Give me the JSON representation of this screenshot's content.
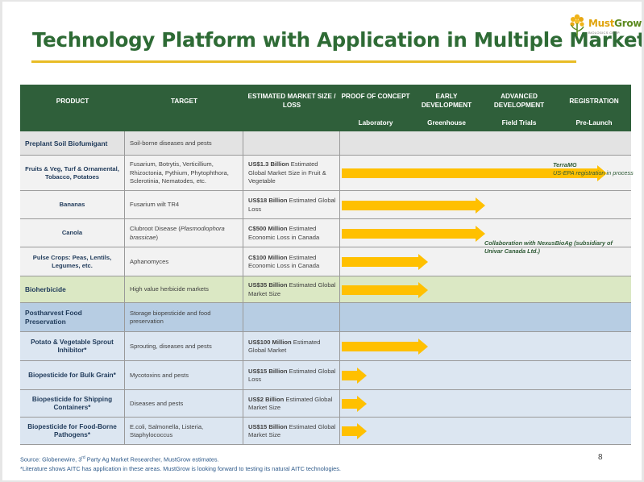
{
  "title": "Technology Platform with Application in Multiple Markets",
  "logo": {
    "brand_part1": "Must",
    "brand_part2": "Grow",
    "subtitle": "BIOLOGICS CORP."
  },
  "header": {
    "product": "PRODUCT",
    "target": "TARGET",
    "market_size": "ESTIMATED MARKET SIZE / LOSS",
    "stages": [
      {
        "label": "PROOF OF CONCEPT",
        "sub": "Laboratory"
      },
      {
        "label": "EARLY DEVELOPMENT",
        "sub": "Greenhouse"
      },
      {
        "label": "ADVANCED DEVELOPMENT",
        "sub": "Field Trials"
      },
      {
        "label": "REGISTRATION",
        "sub": "Pre-Launch"
      }
    ]
  },
  "rows": [
    {
      "kind": "category",
      "product": "Preplant Soil Biofumigant",
      "target": "Soil-borne diseases and pests",
      "market_bold": "",
      "market_rest": ""
    },
    {
      "kind": "item",
      "product": "Fruits & Veg, Turf & Ornamental, Tobacco, Potatoes",
      "target": "Fusarium, Botrytis, Verticillium, Rhizoctonia, Pythium, Phytophthora, Sclerotinia, Nematodes, etc.",
      "market_bold": "US$1.3 Billion",
      "market_rest": " Estimated Global Market Size in Fruit & Vegetable",
      "progress_stage": 3.7
    },
    {
      "kind": "item",
      "product": "Bananas",
      "target": "Fusarium wilt TR4",
      "market_bold": "US$18 Billion",
      "market_rest": " Estimated Global Loss",
      "progress_stage": 2.0
    },
    {
      "kind": "item",
      "product": "Canola",
      "target_pre": "Clubroot Disease (",
      "target_it": "Plasmodiophora brassicae",
      "target_post": ")",
      "market_bold": "C$500 Million",
      "market_rest": " Estimated Economic Loss in Canada",
      "progress_stage": 2.0
    },
    {
      "kind": "item",
      "product": "Pulse Crops: Peas, Lentils, Legumes, etc.",
      "target": "Aphanomyces",
      "market_bold": "C$100 Million",
      "market_rest": " Estimated Economic Loss in Canada",
      "progress_stage": 1.2
    },
    {
      "kind": "category",
      "product": "Bioherbicide",
      "target": "High value herbicide markets",
      "market_bold": "US$35 Billion",
      "market_rest": " Estimated Global Market Size",
      "progress_stage": 1.2
    },
    {
      "kind": "category",
      "product": "Postharvest Food Preservation",
      "target": "Storage biopesticide and food preservation",
      "market_bold": "",
      "market_rest": ""
    },
    {
      "kind": "item",
      "product": "Potato & Vegetable Sprout Inhibitor*",
      "target": "Sprouting, diseases and pests",
      "market_bold": "US$100 Million",
      "market_rest": " Estimated Global Market",
      "progress_stage": 1.2
    },
    {
      "kind": "item",
      "product": "Biopesticide for Bulk Grain*",
      "target": "Mycotoxins and pests",
      "market_bold": "US$15 Billion",
      "market_rest": " Estimated Global Loss",
      "progress_stage": 0.35
    },
    {
      "kind": "item",
      "product": "Biopesticide for Shipping Containers*",
      "target": "Diseases and pests",
      "market_bold": "US$2 Billion",
      "market_rest": " Estimated Global Market Size",
      "progress_stage": 0.35
    },
    {
      "kind": "item",
      "product": "Biopesticide for Food-Borne Pathogens*",
      "target": "E.coli, Salmonella, Listeria, Staphylococcus",
      "market_bold": "US$15 Billion",
      "market_rest": " Estimated Global Market Size",
      "progress_stage": 0.35
    }
  ],
  "notes": {
    "terramg_title": "TerraMG",
    "terramg_body": "US-EPA registration in process",
    "collab": "Collaboration with NexusBioAg (subsidiary of Univar Canada Ltd.)"
  },
  "footer": {
    "source_pre": "Source: Globenewire, 3",
    "source_sup": "rd",
    "source_post": " Party Ag Market Researcher, MustGrow estimates.",
    "literature": "*Literature shows AITC has application in these areas. MustGrow is looking forward to testing its natural AITC technologies.",
    "page_number": "8"
  },
  "colors": {
    "title_green": "#2e6b35",
    "header_bg": "#2f5f3a",
    "accent_gold": "#e8bc26",
    "arrow_yellow": "#ffc000",
    "soil_category_bg": "#e3e3e3",
    "soil_item_bg": "#f2f2f2",
    "herbicide_bg": "#dbe8c4",
    "postharvest_category_bg": "#b7cde3",
    "postharvest_item_bg": "#dce6f1"
  }
}
